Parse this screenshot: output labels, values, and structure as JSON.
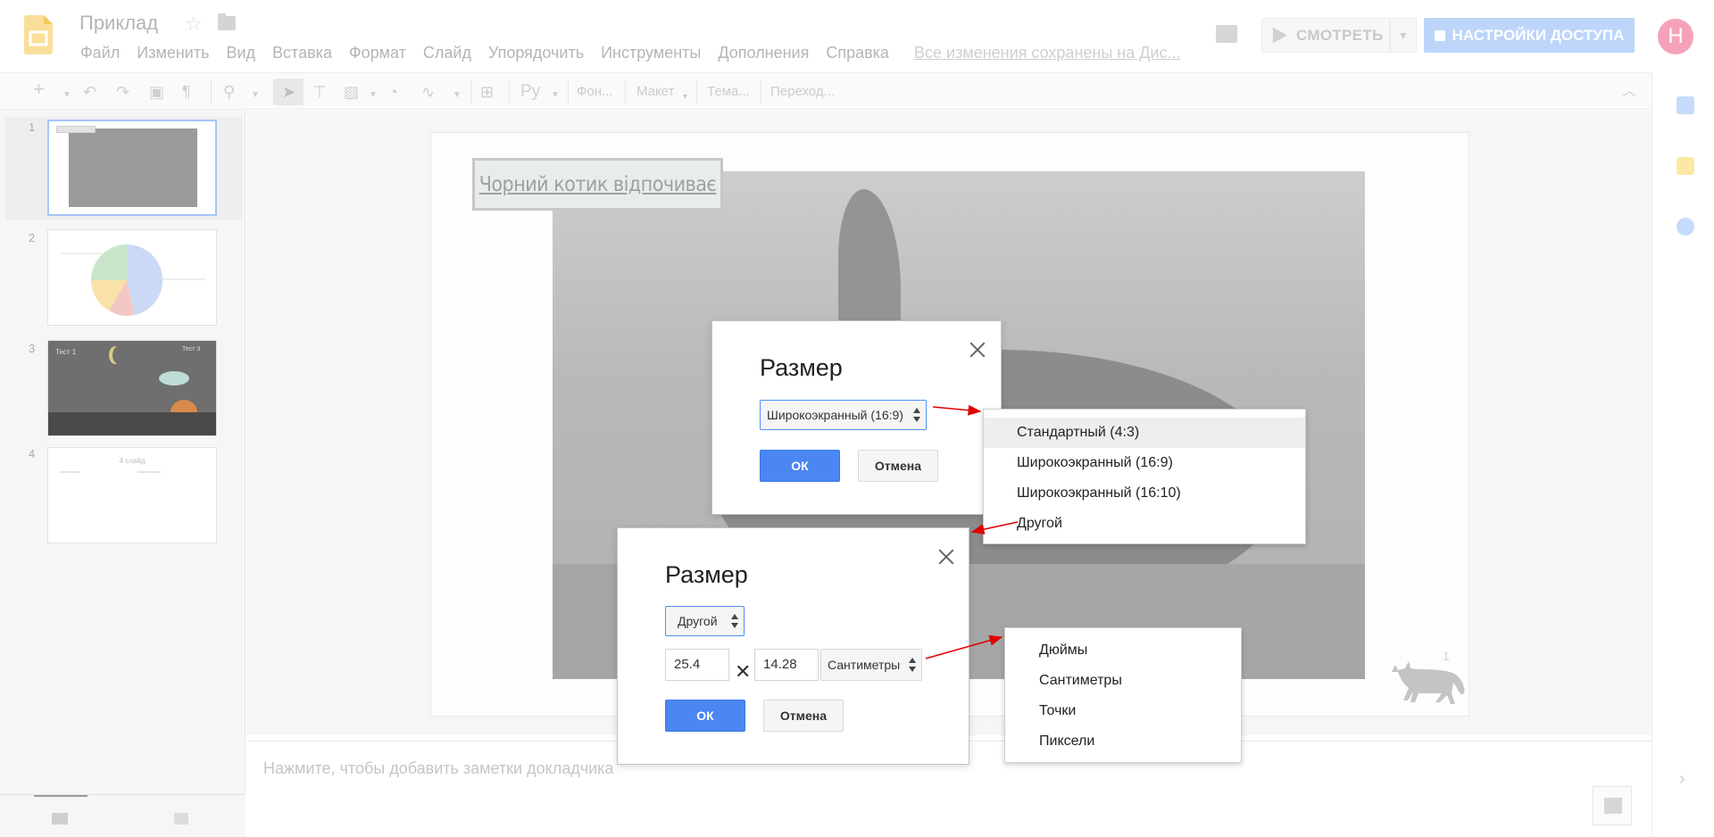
{
  "header": {
    "doc_title": "Приклад",
    "menu": [
      "Файл",
      "Изменить",
      "Вид",
      "Вставка",
      "Формат",
      "Слайд",
      "Упорядочить",
      "Инструменты",
      "Дополнения",
      "Справка"
    ],
    "saved_status": "Все изменения сохранены на Дис...",
    "present_label": "СМОТРЕТЬ",
    "share_label": "НАСТРОЙКИ ДОСТУПА",
    "avatar_letter": "Н"
  },
  "toolbar": {
    "font_label": "Фон...",
    "layout_label": "Макет",
    "theme_label": "Тема...",
    "transition_label": "Переход..."
  },
  "filmstrip": {
    "slide_numbers": [
      "1",
      "2",
      "3",
      "4"
    ],
    "thumb3_text_left": "Тест 1",
    "thumb3_text_right": "Тест 3",
    "thumb4_title": "4 слайд"
  },
  "slide": {
    "title": "Чорний котик відпочиває",
    "number": "1"
  },
  "notes": {
    "placeholder": "Нажмите, чтобы добавить заметки докладчика"
  },
  "dialog1": {
    "title": "Размер",
    "select_value": "Широкоэкранный (16:9)",
    "ok_label": "ОК",
    "cancel_label": "Отмена"
  },
  "dropdown1": {
    "options": [
      "Стандартный (4:3)",
      "Широкоэкранный (16:9)",
      "Широкоэкранный (16:10)",
      "Другой"
    ]
  },
  "dialog2": {
    "title": "Размер",
    "select_value": "Другой",
    "width_value": "25.4",
    "height_value": "14.28",
    "unit_value": "Сантиметры",
    "ok_label": "ОК",
    "cancel_label": "Отмена"
  },
  "dropdown2": {
    "options": [
      "Дюймы",
      "Сантиметры",
      "Точки",
      "Пиксели"
    ]
  },
  "colors": {
    "accent": "#4a87f2",
    "annotation_arrow": "#e00000",
    "share_button": "#bcd5f9",
    "avatar": "#f5a2b8"
  }
}
